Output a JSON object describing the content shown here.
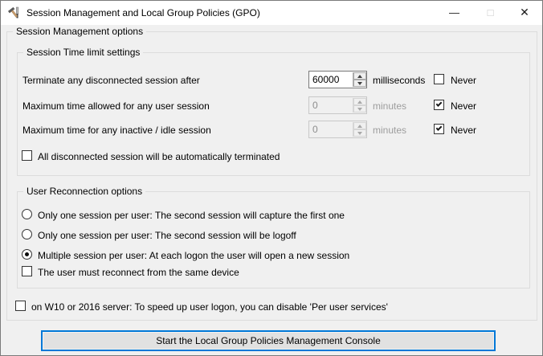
{
  "window": {
    "title": "Session Management and Local Group Policies (GPO)",
    "minimize_glyph": "—",
    "maximize_glyph": "□",
    "close_glyph": "✕"
  },
  "colors": {
    "accent": "#0078d7",
    "dialog_bg": "#f0f0f0",
    "titlebar_bg": "#ffffff",
    "group_border": "#dcdcdc",
    "disabled_text": "#9d9d9d"
  },
  "outer_group": {
    "label": "Session Management options"
  },
  "time_limits": {
    "label": "Session Time limit settings",
    "never_label": "Never",
    "rows": [
      {
        "label": "Terminate any disconnected session after",
        "value": "60000",
        "unit": "milliseconds",
        "never": false,
        "disabled": false
      },
      {
        "label": "Maximum time allowed for any user session",
        "value": "0",
        "unit": "minutes",
        "never": true,
        "disabled": true
      },
      {
        "label": "Maximum time for any inactive / idle session",
        "value": "0",
        "unit": "minutes",
        "never": true,
        "disabled": true
      }
    ],
    "auto_terminate_checkbox": {
      "label": "All disconnected session will be automatically terminated",
      "checked": false
    }
  },
  "reconnection": {
    "label": "User Reconnection options",
    "radios": [
      {
        "label": "Only one session per user: The second session will capture the first one",
        "selected": false
      },
      {
        "label": "Only one session per user: The second session will be logoff",
        "selected": false
      },
      {
        "label": "Multiple session per user: At each logon the user will open a new session",
        "selected": true
      }
    ],
    "same_device_checkbox": {
      "label": "The user must reconnect from the same device",
      "checked": false
    }
  },
  "per_user_services_checkbox": {
    "label": "on W10 or 2016 server: To speed up user logon, you can disable 'Per user services'",
    "checked": false
  },
  "start_button": {
    "label": "Start the Local Group Policies Management Console"
  }
}
